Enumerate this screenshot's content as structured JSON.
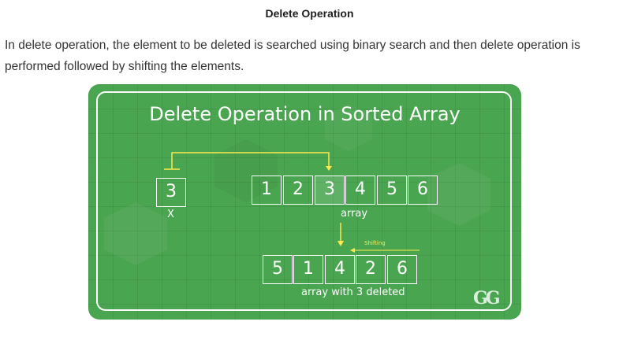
{
  "heading": "Delete Operation",
  "paragraph": "In delete operation, the element to be deleted is searched using binary search and then delete operation is performed followed by shifting the elements.",
  "figure": {
    "title": "Delete Operation in Sorted Array",
    "key_value": "3",
    "key_label": "X",
    "array": [
      "1",
      "2",
      "3",
      "4",
      "5",
      "6"
    ],
    "array_label": "array",
    "shifting_label": "Shifting",
    "result": [
      "5",
      "1",
      "4",
      "2",
      "6"
    ],
    "result_label": "array with 3 deleted",
    "logo_text": "GG",
    "colors": {
      "background": "#4aa551",
      "arrow": "#ffe94d",
      "stroke": "#ffffff"
    }
  }
}
